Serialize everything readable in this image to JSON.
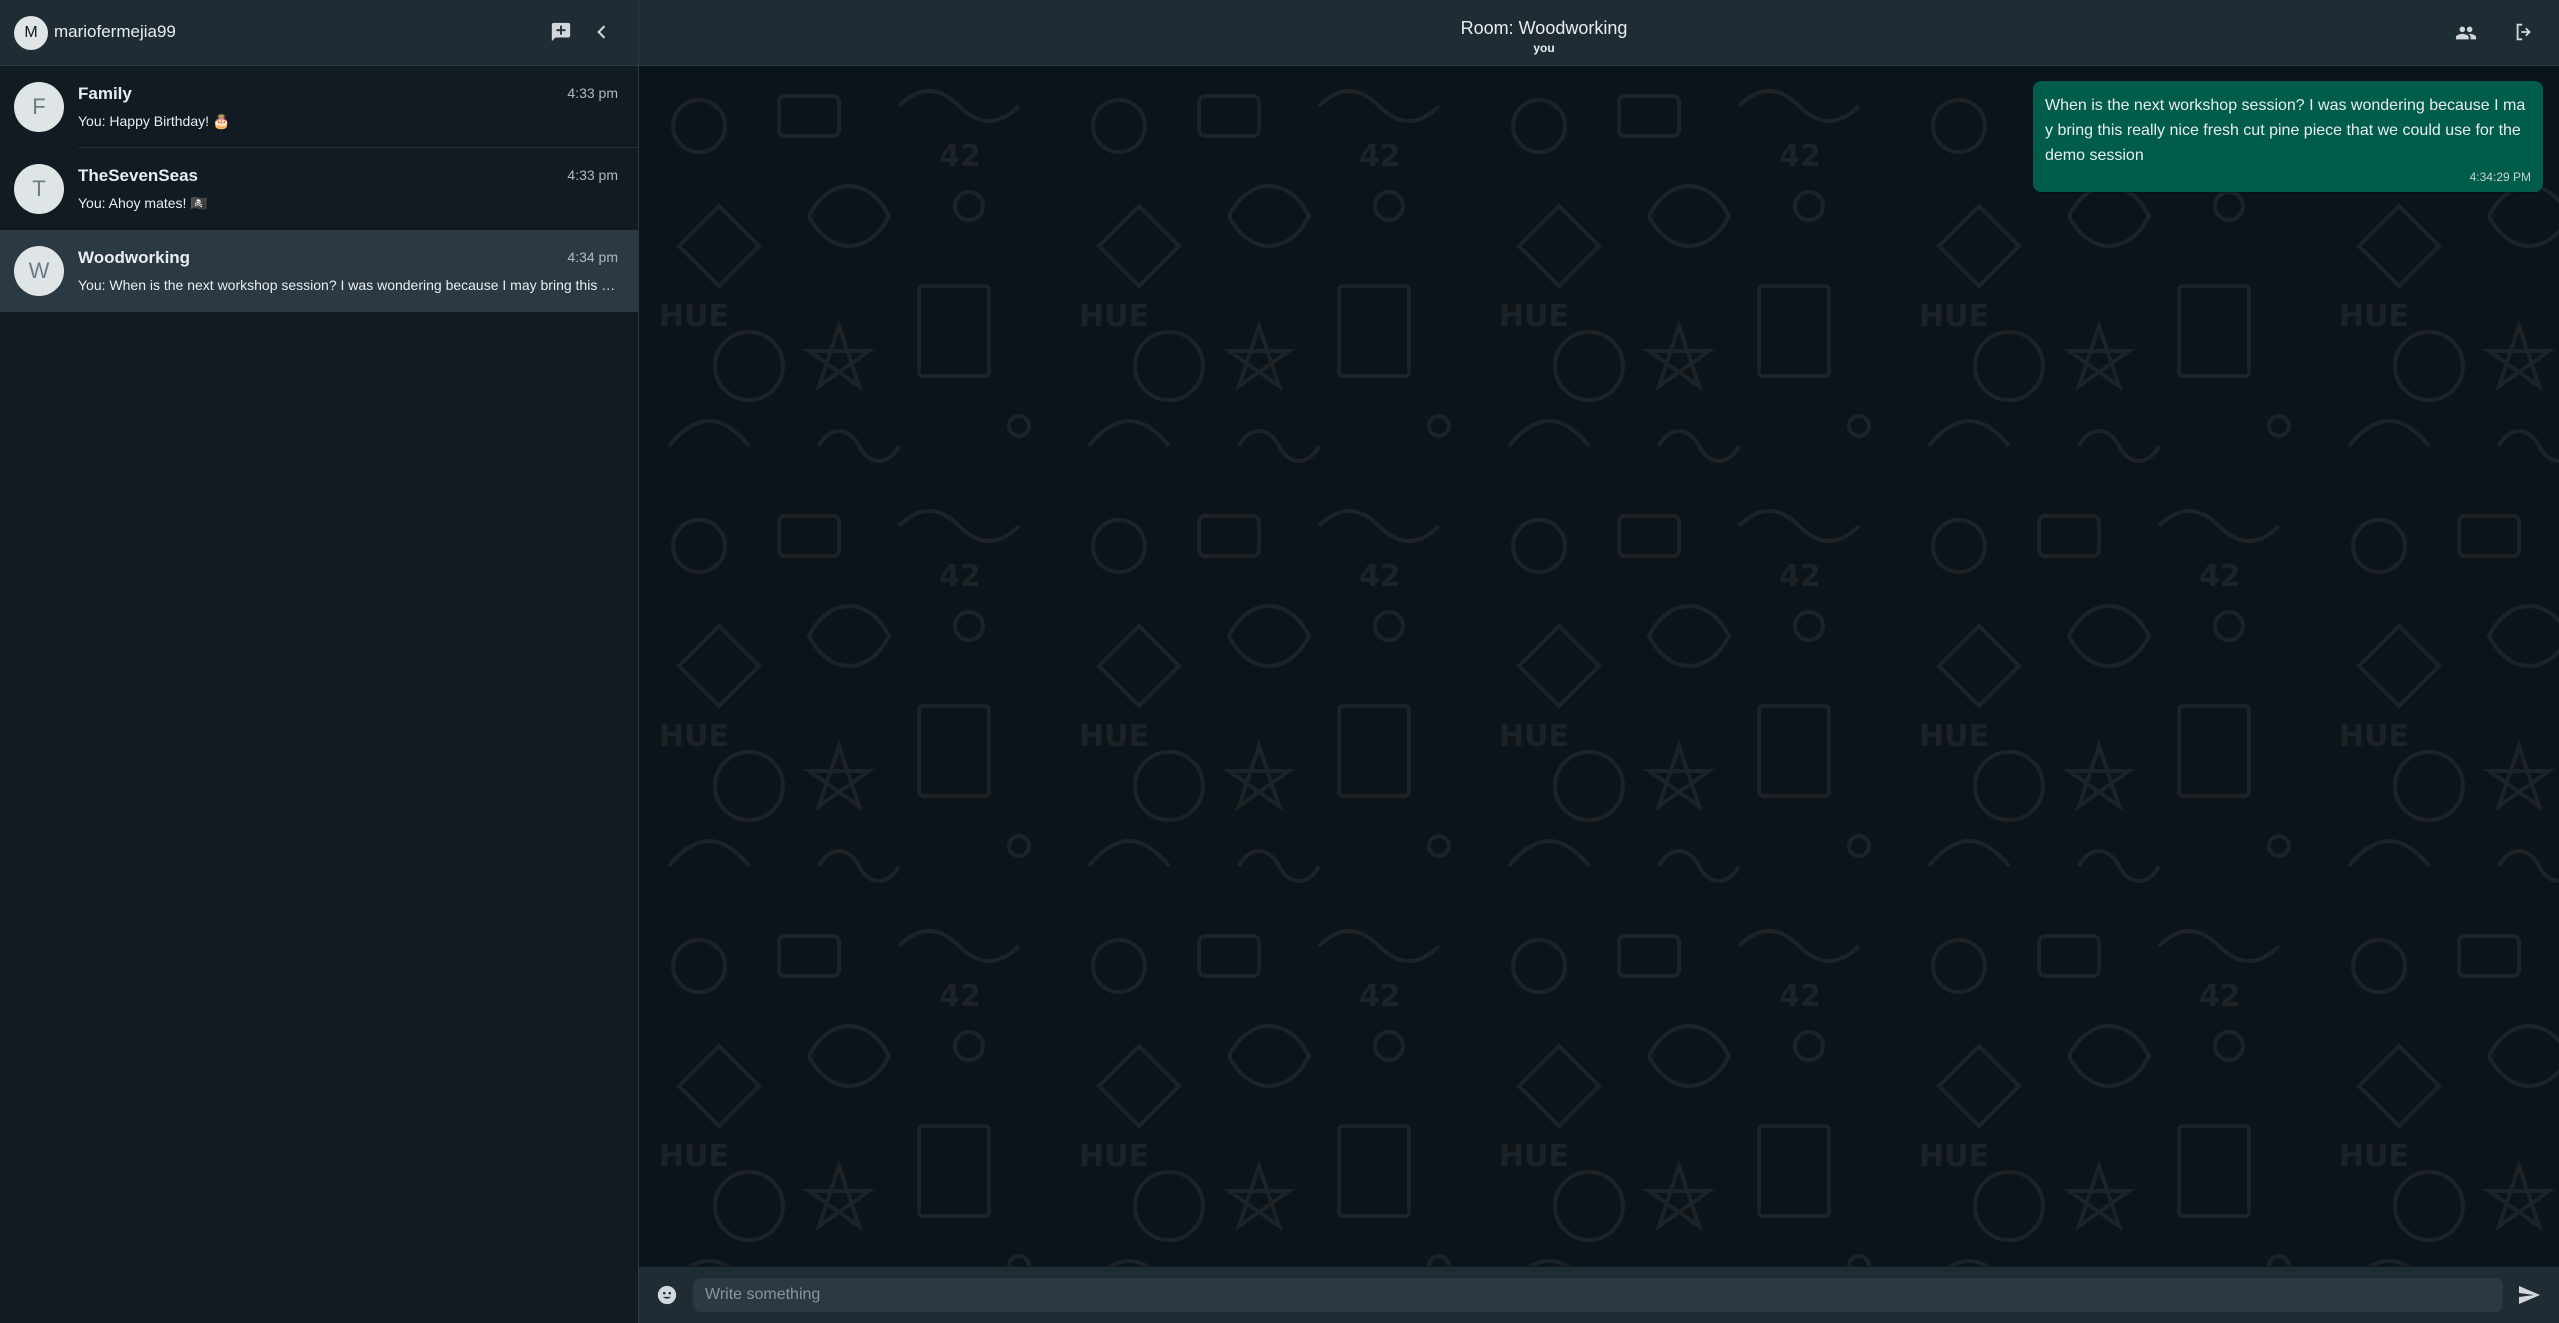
{
  "user": {
    "avatar_letter": "M",
    "username": "mariofermejia99"
  },
  "chats": [
    {
      "avatar_letter": "F",
      "name": "Family",
      "time": "4:33 pm",
      "preview": "You: Happy Birthday! 🎂",
      "active": false
    },
    {
      "avatar_letter": "T",
      "name": "TheSevenSeas",
      "time": "4:33 pm",
      "preview": "You: Ahoy mates! 🏴‍☠️",
      "active": false
    },
    {
      "avatar_letter": "W",
      "name": "Woodworking",
      "time": "4:34 pm",
      "preview": "You: When is the next workshop session? I was wondering because I may bring this really nice fresh cut pine piece that we could use for the demo session",
      "active": true
    }
  ],
  "room": {
    "title": "Room: Woodworking",
    "subtitle": "you"
  },
  "messages": [
    {
      "text": "When is the next workshop session? I was wondering because I may bring this really nice fresh cut pine piece that we could use for the demo session",
      "time": "4:34:29 PM",
      "outgoing": true
    }
  ],
  "composer": {
    "placeholder": "Write something"
  },
  "icons": {
    "new_chat": "new-chat-icon",
    "collapse": "chevron-left-icon",
    "members": "people-icon",
    "logout": "logout-icon",
    "emoji": "emoji-icon",
    "send": "send-icon"
  },
  "colors": {
    "accent": "#005c4b",
    "panel": "#202c33",
    "background": "#0b141a"
  }
}
